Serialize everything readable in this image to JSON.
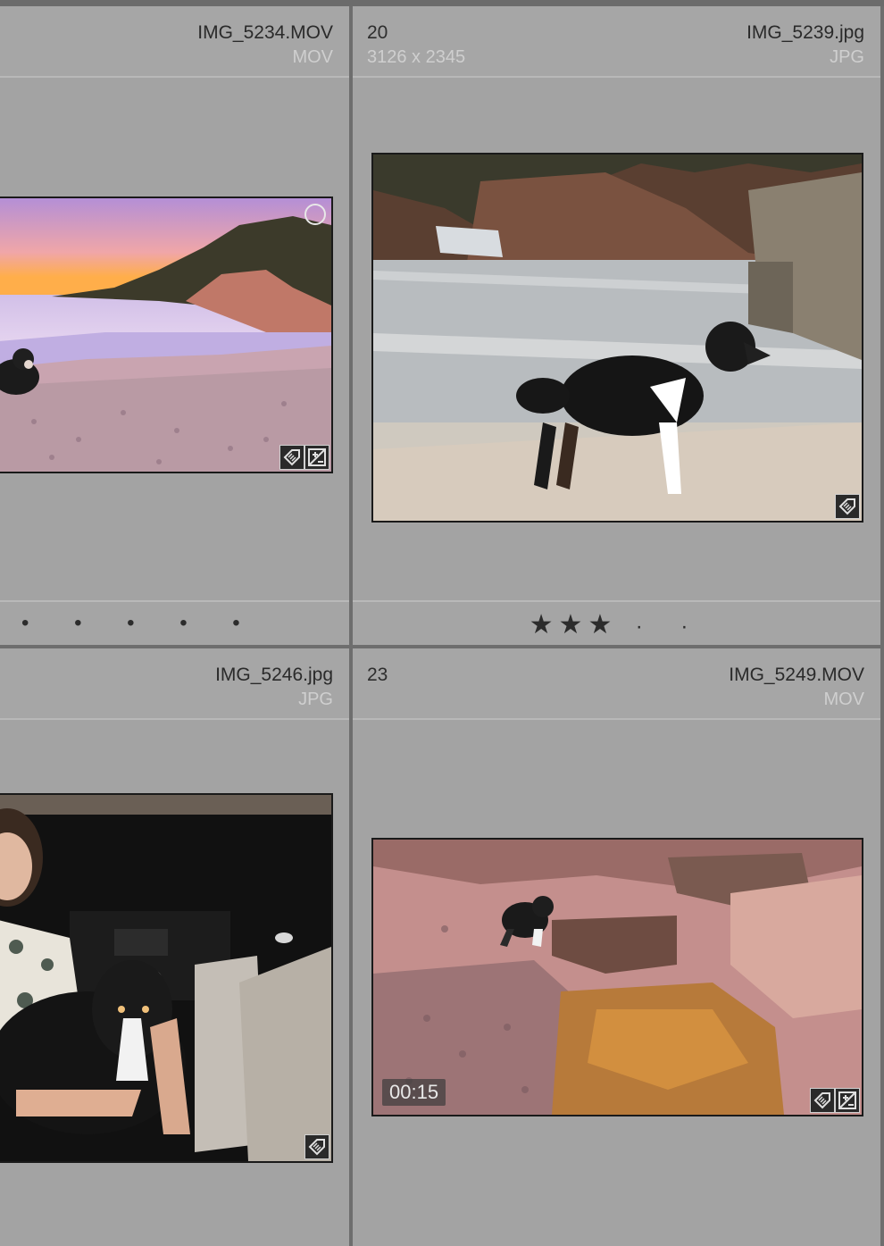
{
  "cells": [
    {
      "index": "",
      "filename": "IMG_5234.MOV",
      "meta_left": "",
      "meta_right": "MOV",
      "rating_stars": "",
      "rating_dots": "• • • • •"
    },
    {
      "index": "20",
      "filename": "IMG_5239.jpg",
      "meta_left": "3126 x 2345",
      "meta_right": "JPG",
      "rating_stars": "★★★",
      "rating_dots": "· ·"
    },
    {
      "index": "",
      "filename": "IMG_5246.jpg",
      "meta_left": "",
      "meta_right": "JPG"
    },
    {
      "index": "23",
      "filename": "IMG_5249.MOV",
      "meta_left": "",
      "meta_right": "MOV",
      "duration": "00:15"
    }
  ],
  "icons": {
    "edited": "develop-adjusted-icon",
    "tagged": "keyword-tag-icon",
    "select": "select-circle-icon"
  }
}
